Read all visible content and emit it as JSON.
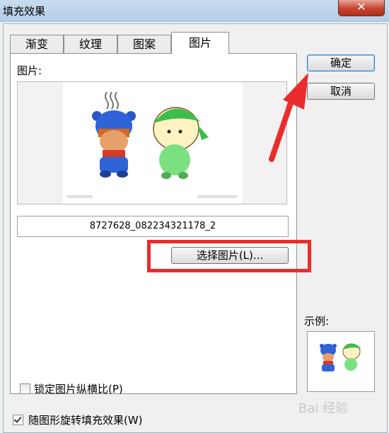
{
  "window": {
    "title": "填充效果",
    "close_glyph": "✕"
  },
  "tabs": [
    {
      "label": "渐变",
      "active": false
    },
    {
      "label": "纹理",
      "active": false
    },
    {
      "label": "图案",
      "active": false
    },
    {
      "label": "图片",
      "active": true
    }
  ],
  "picture_panel": {
    "picture_label": "图片:",
    "image_name": "8727628_082234321178_2",
    "select_button": "选择图片(L)...",
    "lock_aspect_label": "锁定图片纵横比(P)",
    "lock_aspect_checked": false
  },
  "rotate_with_shape_label": "随图形旋转填充效果(W)",
  "rotate_with_shape_checked": true,
  "buttons": {
    "ok": "确定",
    "cancel": "取消"
  },
  "sample": {
    "label": "示例:"
  },
  "watermark": "Bai 经验",
  "colors": {
    "annotation_red": "#ea2c2c",
    "titlebar": "#b4cde6",
    "close": "#c6442f"
  }
}
